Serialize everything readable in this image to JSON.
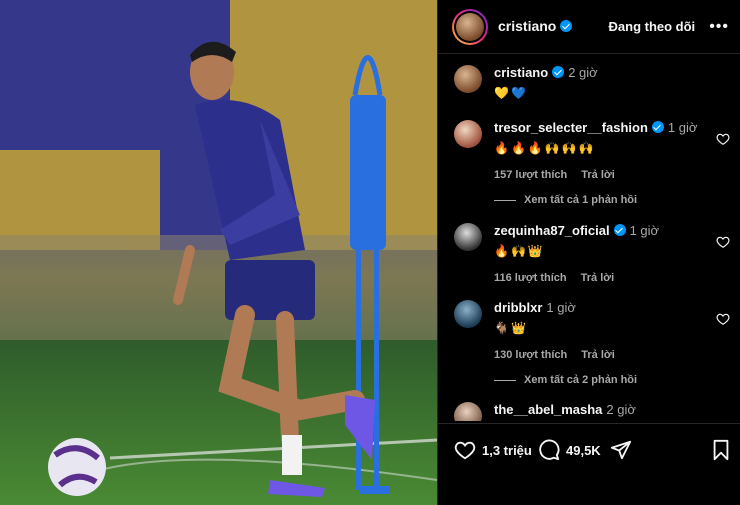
{
  "post": {
    "author": "cristiano",
    "follow_label": "Đang theo dõi",
    "more_label": "•••",
    "caption_time": "2 giờ",
    "caption_emojis": "💛💙"
  },
  "comments": [
    {
      "user": "tresor_selecter__fashion",
      "verified": true,
      "time": "1 giờ",
      "emojis": "🔥🔥🔥🙌🙌🙌",
      "likes": "157 lượt thích",
      "reply": "Trả lời",
      "view_replies": "Xem tất cả 1 phản hồi"
    },
    {
      "user": "zequinha87_oficial",
      "verified": true,
      "time": "1 giờ",
      "emojis": "🔥🙌👑",
      "likes": "116 lượt thích",
      "reply": "Trả lời"
    },
    {
      "user": "dribblxr",
      "verified": false,
      "time": "1 giờ",
      "emojis": "🐐👑",
      "likes": "130 lượt thích",
      "reply": "Trả lời",
      "view_replies": "Xem tất cả 2 phản hồi"
    },
    {
      "user": "the__abel_masha",
      "verified": false,
      "time": "2 giờ",
      "emojis": "🔥🔥"
    }
  ],
  "actions": {
    "likes": "1,3 triệu",
    "comments": "49,5K"
  },
  "colors": {
    "accent": "#0095f6",
    "photo_jersey": "#2c2f8c",
    "mannequin": "#2a6fe0"
  }
}
